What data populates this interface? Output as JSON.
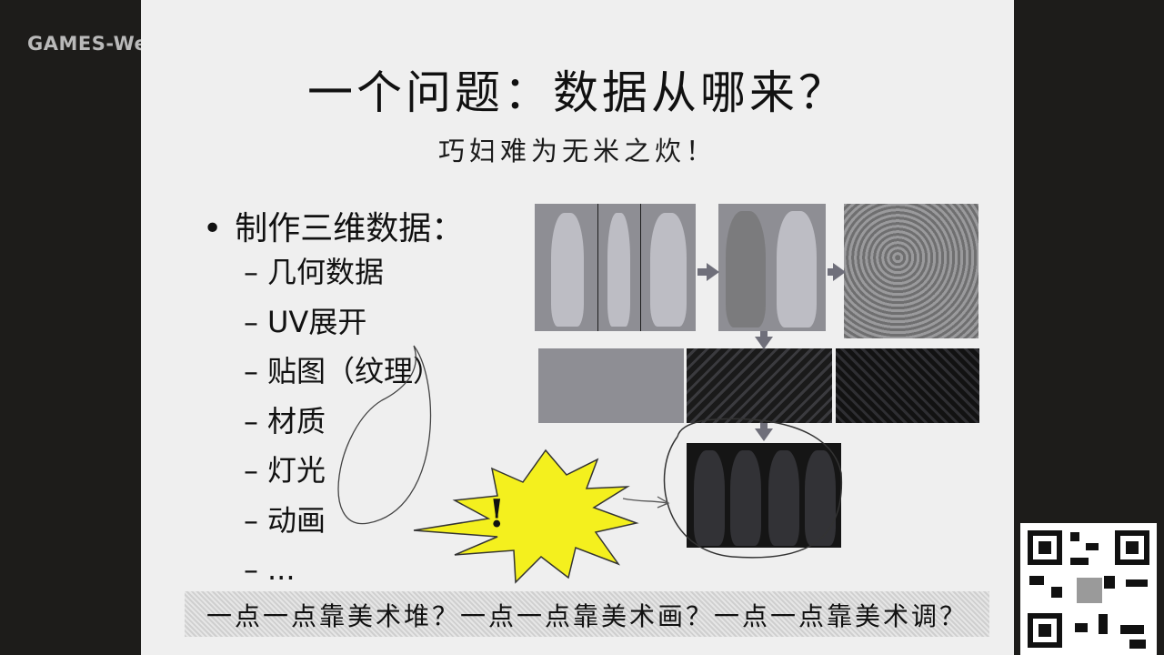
{
  "watermark": "GAMES-We",
  "slide": {
    "title": "一个问题：数据从哪来？",
    "subtitle": "巧妇难为无米之炊！",
    "main_bullet": "制作三维数据：",
    "bullet_symbol": "•",
    "dash": "–",
    "items": [
      "几何数据",
      "UV展开",
      "贴图（纹理）",
      "材质",
      "灯光",
      "动画",
      "..."
    ],
    "exclamation": "!",
    "bottom_note": "一点一点靠美术堆？一点一点靠美术画？一点一点靠美术调？"
  },
  "colors": {
    "slide_bg": "#efefef",
    "starburst": "#f4f01e",
    "arrow": "#6f6f7a",
    "side_bg": "#1d1c1a"
  }
}
